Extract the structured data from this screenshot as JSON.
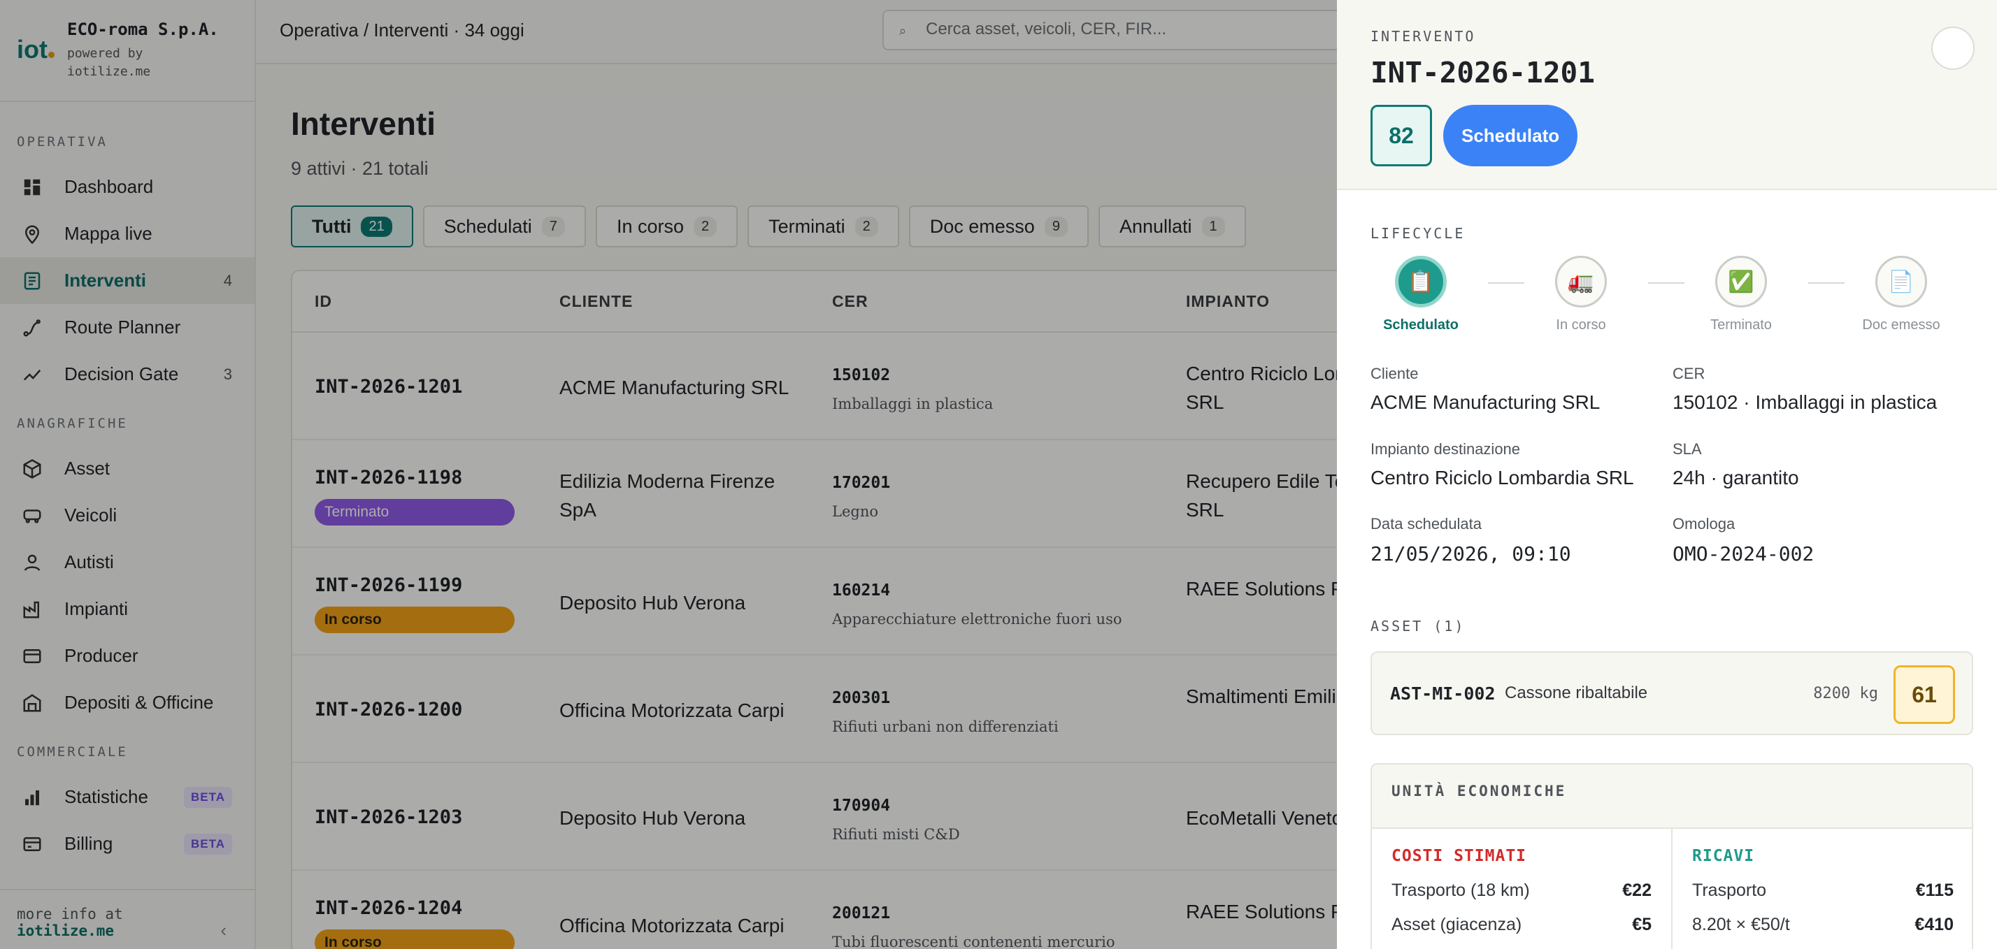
{
  "brand": {
    "logo": "iot",
    "company": "ECO-roma S.p.A.",
    "powered_line1": "powered by",
    "powered_line2": "iotilize.me"
  },
  "sidebar": {
    "sections": [
      {
        "label": "OPERATIVA",
        "items": [
          {
            "label": "Dashboard",
            "icon": "dashboard-icon",
            "count": ""
          },
          {
            "label": "Mappa live",
            "icon": "map-pin-icon",
            "count": ""
          },
          {
            "label": "Interventi",
            "icon": "document-icon",
            "count": "4",
            "active": true
          },
          {
            "label": "Route Planner",
            "icon": "route-icon",
            "count": ""
          },
          {
            "label": "Decision Gate",
            "icon": "trend-icon",
            "count": "3"
          }
        ]
      },
      {
        "label": "ANAGRAFICHE",
        "items": [
          {
            "label": "Asset",
            "icon": "cube-icon"
          },
          {
            "label": "Veicoli",
            "icon": "truck-icon"
          },
          {
            "label": "Autisti",
            "icon": "user-icon"
          },
          {
            "label": "Impianti",
            "icon": "factory-icon"
          },
          {
            "label": "Producer",
            "icon": "card-icon"
          },
          {
            "label": "Depositi & Officine",
            "icon": "warehouse-icon"
          }
        ]
      },
      {
        "label": "COMMERCIALE",
        "items": [
          {
            "label": "Statistiche",
            "icon": "bar-chart-icon",
            "badge": "BETA"
          },
          {
            "label": "Billing",
            "icon": "billing-icon",
            "badge": "BETA"
          }
        ]
      }
    ],
    "footer_text": "more info at",
    "footer_link": "iotilize.me",
    "collapse_glyph": "‹"
  },
  "topbar": {
    "breadcrumb": "Operativa / Interventi · 34 oggi",
    "search_placeholder": "Cerca asset, veicoli, CER, FIR..."
  },
  "main": {
    "title": "Interventi",
    "subtitle": "9 attivi · 21 totali",
    "tabs": [
      {
        "label": "Tutti",
        "count": "21"
      },
      {
        "label": "Schedulati",
        "count": "7"
      },
      {
        "label": "In corso",
        "count": "2"
      },
      {
        "label": "Terminati",
        "count": "2"
      },
      {
        "label": "Doc emesso",
        "count": "9"
      },
      {
        "label": "Annullati",
        "count": "1"
      }
    ],
    "columns": [
      "ID",
      "CLIENTE",
      "CER",
      "IMPIANTO"
    ],
    "rows": [
      {
        "id": "INT-2026-1201",
        "status": "",
        "client": "ACME Manufacturing SRL",
        "cer_code": "150102",
        "cer_desc": "Imballaggi in plastica",
        "impianto": "Centro Riciclo Lombardia SRL"
      },
      {
        "id": "INT-2026-1198",
        "status": "Terminato",
        "client": "Edilizia Moderna Firenze SpA",
        "cer_code": "170201",
        "cer_desc": "Legno",
        "impianto": "Recupero Edile Toscano SRL"
      },
      {
        "id": "INT-2026-1199",
        "status": "In corso",
        "client": "Deposito Hub Verona",
        "cer_code": "160214",
        "cer_desc": "Apparecchiature elettroniche fuori uso",
        "impianto": "RAEE Solutions Piemonte"
      },
      {
        "id": "INT-2026-1200",
        "status": "",
        "client": "Officina Motorizzata Carpi",
        "cer_code": "200301",
        "cer_desc": "Rifiuti urbani non differenziati",
        "impianto": "Smaltimenti Emiliani Coop."
      },
      {
        "id": "INT-2026-1203",
        "status": "",
        "client": "Deposito Hub Verona",
        "cer_code": "170904",
        "cer_desc": "Rifiuti misti C&D",
        "impianto": "EcoMetalli Veneto SRL"
      },
      {
        "id": "INT-2026-1204",
        "status": "In corso",
        "client": "Officina Motorizzata Carpi",
        "cer_code": "200121",
        "cer_desc": "Tubi fluorescenti contenenti mercurio",
        "impianto": "RAEE Solutions Piemonte"
      }
    ]
  },
  "drawer": {
    "kicker": "INTERVENTO",
    "title": "INT-2026-1201",
    "score": "82",
    "status": "Schedulato",
    "lifecycle_label": "LIFECYCLE",
    "steps": [
      {
        "label": "Schedulato",
        "glyph": "📋"
      },
      {
        "label": "In corso",
        "glyph": "🚛"
      },
      {
        "label": "Terminato",
        "glyph": "✅"
      },
      {
        "label": "Doc emesso",
        "glyph": "📄"
      }
    ],
    "fields": {
      "cliente_label": "Cliente",
      "cliente": "ACME Manufacturing SRL",
      "cer_label": "CER",
      "cer": "150102 · Imballaggi in plastica",
      "impianto_label": "Impianto destinazione",
      "impianto": "Centro Riciclo Lombardia SRL",
      "sla_label": "SLA",
      "sla": "24h · garantito",
      "data_label": "Data schedulata",
      "data": "21/05/2026, 09:10",
      "omologa_label": "Omologa",
      "omologa": "OMO-2024-002"
    },
    "asset_label": "ASSET (1)",
    "asset": {
      "code": "AST-MI-002",
      "name": "Cassone ribaltabile",
      "weight": "8200 kg",
      "score": "61"
    },
    "economics": {
      "title": "UNITÀ ECONOMICHE",
      "costs_title": "COSTI STIMATI",
      "costs": [
        {
          "label": "Trasporto (18 km)",
          "amount": "€22"
        },
        {
          "label": "Asset (giacenza)",
          "amount": "€5"
        }
      ],
      "revenue_title": "RICAVI",
      "revenue": [
        {
          "label": "Trasporto",
          "amount": "€115"
        },
        {
          "label": "8.20t × €50/t",
          "amount": "€410"
        }
      ]
    }
  }
}
